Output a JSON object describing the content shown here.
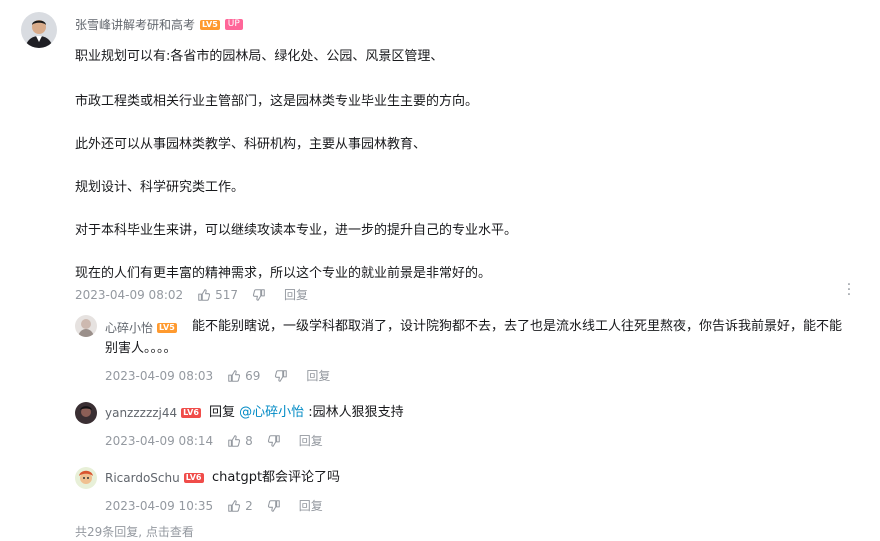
{
  "main_comment": {
    "username": "张雪峰讲解考研和高考",
    "level": "LV5",
    "up_badge": "UP",
    "paragraphs": [
      "职业规划可以有:各省市的园林局、绿化处、公园、风景区管理、",
      "市政工程类或相关行业主管部门，这是园林类专业毕业生主要的方向。",
      "此外还可以从事园林类教学、科研机构，主要从事园林教育、",
      "规划设计、科学研究类工作。",
      "对于本科毕业生来讲，可以继续攻读本专业，进一步的提升自己的专业水平。",
      "现在的人们有更丰富的精神需求，所以这个专业的就业前景是非常好的。"
    ],
    "time": "2023-04-09 08:02",
    "likes": "517",
    "reply_label": "回复"
  },
  "replies": [
    {
      "username": "心碎小怡",
      "level": "LV5",
      "text_line1": "能不能别瞎说，一级学科都取消了，设计院狗都不去，去了也是流水线工人往死里熬夜，你告诉我前景好，能不能",
      "text_line2": "别害人。。。。",
      "time": "2023-04-09 08:03",
      "likes": "69",
      "reply_label": "回复"
    },
    {
      "username": "yanzzzzzj44",
      "level": "LV6",
      "reply_prefix": "回复 ",
      "mention": "@心碎小怡",
      "text": " :园林人狠狠支持",
      "time": "2023-04-09 08:14",
      "likes": "8",
      "reply_label": "回复"
    },
    {
      "username": "RicardoSchu",
      "level": "LV6",
      "text": "chatgpt都会评论了吗",
      "time": "2023-04-09 10:35",
      "likes": "2",
      "reply_label": "回复"
    }
  ],
  "footer": {
    "summary": "共29条回复, 点击查看"
  },
  "icons": {
    "like": "thumbs-up-icon",
    "dislike": "thumbs-down-icon",
    "more": "more-vertical-icon"
  },
  "colors": {
    "mention": "#008ac5",
    "lv5": "#ff9a2f",
    "lv6": "#f04c49",
    "up_badge": "#ff6699",
    "meta_text": "#9499a0"
  }
}
